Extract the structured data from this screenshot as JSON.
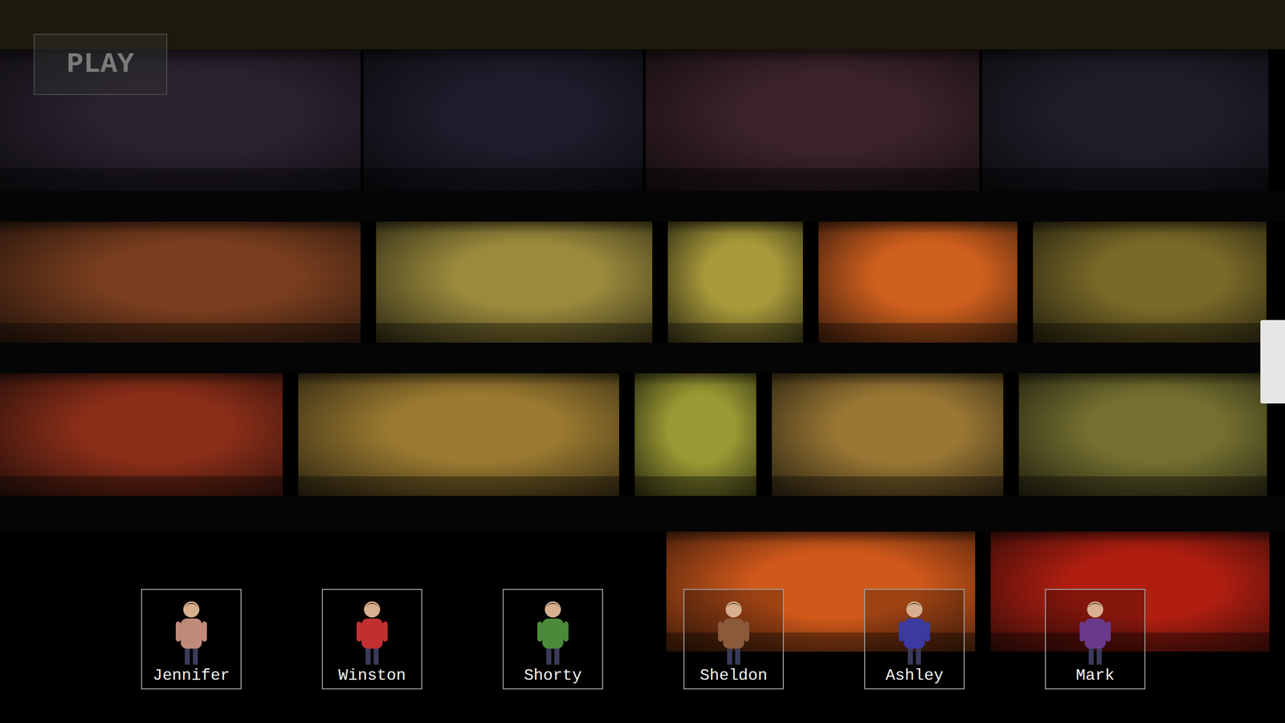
{
  "play_button": {
    "label": "PLAY"
  },
  "floors": [
    {
      "rooms": [
        {
          "color": "#2a2230"
        },
        {
          "color": "#1c1c2a"
        },
        {
          "color": "#3a2228"
        },
        {
          "color": "#1e1e2a"
        }
      ]
    },
    {
      "rooms": [
        {
          "color": "#7a3e1e"
        },
        {
          "color": "#9a8a3c"
        },
        {
          "color": "#a89a3a"
        },
        {
          "color": "#d0601e"
        },
        {
          "color": "#7a6a28"
        }
      ]
    },
    {
      "rooms": [
        {
          "color": "#8a2e18"
        },
        {
          "color": "#9a7a30"
        },
        {
          "color": "#9a9a34"
        },
        {
          "color": "#9a7834"
        },
        {
          "color": "#747030"
        }
      ]
    },
    {
      "rooms": [
        {
          "color": "#d0581a"
        },
        {
          "color": "#b01e10"
        }
      ]
    }
  ],
  "characters": [
    {
      "name": "Jennifer",
      "color": "#c08a78"
    },
    {
      "name": "Winston",
      "color": "#c03030"
    },
    {
      "name": "Shorty",
      "color": "#4a8a3a"
    },
    {
      "name": "Sheldon",
      "color": "#8a5a3a"
    },
    {
      "name": "Ashley",
      "color": "#3a3aa0"
    },
    {
      "name": "Mark",
      "color": "#6a3a8a"
    }
  ]
}
